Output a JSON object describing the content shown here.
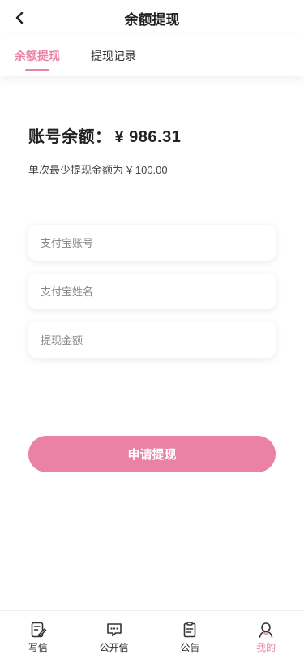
{
  "header": {
    "title": "余额提现"
  },
  "tabs": [
    {
      "label": "余额提现",
      "active": true
    },
    {
      "label": "提现记录",
      "active": false
    }
  ],
  "balance": {
    "label": "账号余额：",
    "amount": "¥ 986.31"
  },
  "min_note": {
    "label": "单次最少提现金额为",
    "amount": "¥ 100.00"
  },
  "form": {
    "alipay_account_placeholder": "支付宝账号",
    "alipay_name_placeholder": "支付宝姓名",
    "amount_placeholder": "提现金额",
    "alipay_account_value": "",
    "alipay_name_value": "",
    "amount_value": ""
  },
  "submit": {
    "label": "申请提现"
  },
  "tabbar": {
    "items": [
      {
        "label": "写信",
        "icon": "write-letter-icon",
        "active": false
      },
      {
        "label": "公开信",
        "icon": "open-letter-icon",
        "active": false
      },
      {
        "label": "公告",
        "icon": "notice-icon",
        "active": false
      },
      {
        "label": "我的",
        "icon": "profile-icon",
        "active": true
      }
    ]
  },
  "colors": {
    "accent": "#ea82a6",
    "text": "#333333",
    "placeholder": "#888888"
  }
}
